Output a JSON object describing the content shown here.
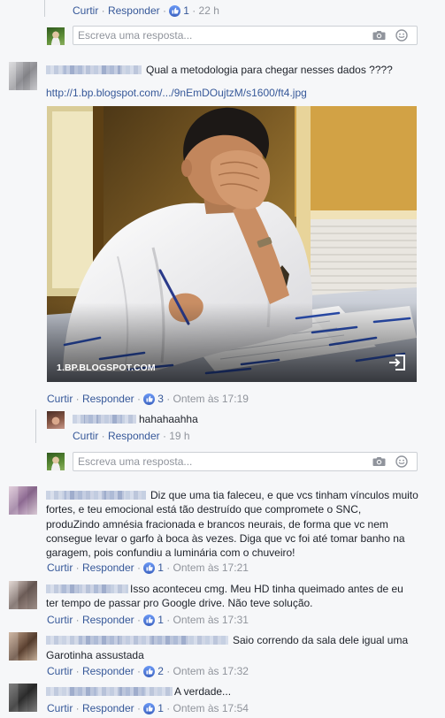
{
  "ui": {
    "like_label": "Curtir",
    "reply_label": "Responder",
    "separator": "·",
    "reply_placeholder": "Escreva uma resposta..."
  },
  "colors": {
    "background": "#f6f7f9",
    "link": "#365899",
    "text": "#1d2129",
    "meta": "#90949c",
    "like_badge": "#4267b2",
    "input_border": "#ccd0d5"
  },
  "icons": {
    "like": "thumbs-up-icon",
    "camera": "camera-icon",
    "emoji": "emoji-icon",
    "open_link": "open-link-icon"
  },
  "previous_reply": {
    "like_count": "1",
    "time": "22 h"
  },
  "comments": [
    {
      "text_lines": [
        "Qual a metodologia para chegar nesses dados ????"
      ],
      "link": "http://1.bp.blogspot.com/.../9nEmDOujtzM/s1600/ft4.jpg",
      "attachment": {
        "source": "1.BP.BLOGSPOT.COM"
      },
      "like_count": "3",
      "time": "Ontem às 17:19",
      "replies": [
        {
          "text_lines": [
            "hahahaahha"
          ],
          "time": "19 h"
        }
      ]
    },
    {
      "text_lines": [
        "Diz que uma tia faleceu, e que vcs tinham vínculos muito",
        "fortes, e teu emocional está tão destruído que compromete o SNC,",
        "produZindo amnésia fracionada e brancos neurais, de forma que vc nem",
        "consegue levar o garfo à boca às vezes. Diga que vc foi até tomar banho na",
        "garagem, pois confundiu a luminária com o chuveiro!"
      ],
      "like_count": "1",
      "time": "Ontem às 17:21"
    },
    {
      "text_lines": [
        "Isso aconteceu cmg. Meu HD tinha queimado antes de eu",
        "ter tempo de passar pro Google drive. Não teve solução."
      ],
      "like_count": "1",
      "time": "Ontem às 17:31"
    },
    {
      "text_lines": [
        "Saio correndo da sala dele igual uma",
        "Garotinha assustada"
      ],
      "like_count": "2",
      "time": "Ontem às 17:32"
    },
    {
      "text_lines": [
        "A verdade..."
      ],
      "like_count": "1",
      "time": "Ontem às 17:54"
    }
  ]
}
